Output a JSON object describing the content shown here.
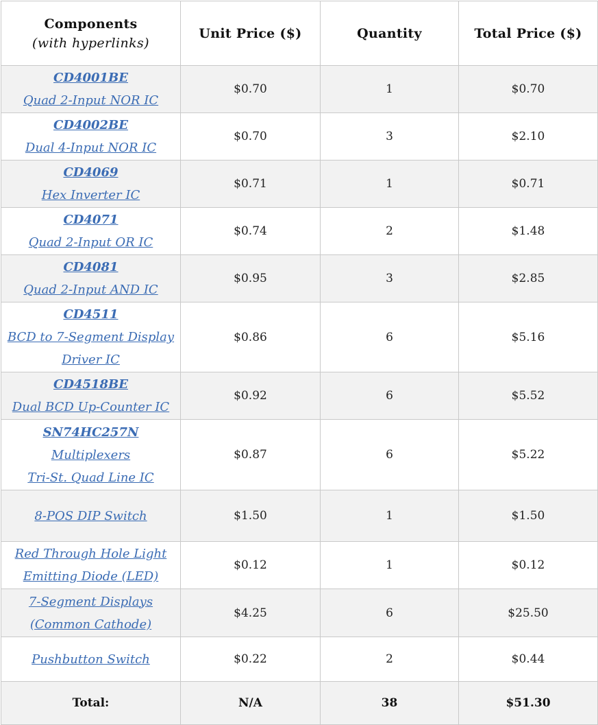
{
  "header": {
    "components": "Components",
    "components_sub": "(with hyperlinks)",
    "unit_price": "Unit Price ($)",
    "quantity": "Quantity",
    "total_price": "Total Price ($)"
  },
  "rows": [
    {
      "part": "CD4001BE",
      "lines": [
        "Quad 2-Input NOR IC"
      ],
      "unit": "$0.70",
      "qty": "1",
      "total": "$0.70"
    },
    {
      "part": "CD4002BE",
      "lines": [
        "Dual 4-Input NOR IC"
      ],
      "unit": "$0.70",
      "qty": "3",
      "total": "$2.10"
    },
    {
      "part": "CD4069",
      "lines": [
        "Hex Inverter IC"
      ],
      "unit": "$0.71",
      "qty": "1",
      "total": "$0.71"
    },
    {
      "part": "CD4071",
      "lines": [
        "Quad 2-Input OR IC"
      ],
      "unit": "$0.74",
      "qty": "2",
      "total": "$1.48"
    },
    {
      "part": "CD4081",
      "lines": [
        "Quad 2-Input AND IC"
      ],
      "unit": "$0.95",
      "qty": "3",
      "total": "$2.85"
    },
    {
      "part": "CD4511",
      "lines": [
        "BCD to 7-Segment Display",
        "Driver IC"
      ],
      "unit": "$0.86",
      "qty": "6",
      "total": "$5.16"
    },
    {
      "part": "CD4518BE",
      "lines": [
        "Dual BCD Up-Counter IC"
      ],
      "unit": "$0.92",
      "qty": "6",
      "total": "$5.52"
    },
    {
      "part": "SN74HC257N",
      "lines": [
        "Multiplexers",
        "Tri-St. Quad Line IC"
      ],
      "unit": "$0.87",
      "qty": "6",
      "total": "$5.22"
    },
    {
      "part": "",
      "lines": [
        "8-POS DIP Switch"
      ],
      "unit": "$1.50",
      "qty": "1",
      "total": "$1.50"
    },
    {
      "part": "",
      "lines": [
        "Red Through Hole Light",
        "Emitting Diode (LED)"
      ],
      "unit": "$0.12",
      "qty": "1",
      "total": "$0.12"
    },
    {
      "part": "",
      "lines": [
        "7-Segment Displays",
        "(Common Cathode)"
      ],
      "unit": "$4.25",
      "qty": "6",
      "total": "$25.50"
    },
    {
      "part": "",
      "lines": [
        "Pushbutton Switch"
      ],
      "unit": "$0.22",
      "qty": "2",
      "total": "$0.44"
    }
  ],
  "totals": {
    "label": "Total:",
    "unit": "N/A",
    "qty": "38",
    "total": "$51.30"
  },
  "colors": {
    "link": "#3b6cb4",
    "alt_row": "#f2f2f2",
    "border": "#c9c9c9"
  }
}
